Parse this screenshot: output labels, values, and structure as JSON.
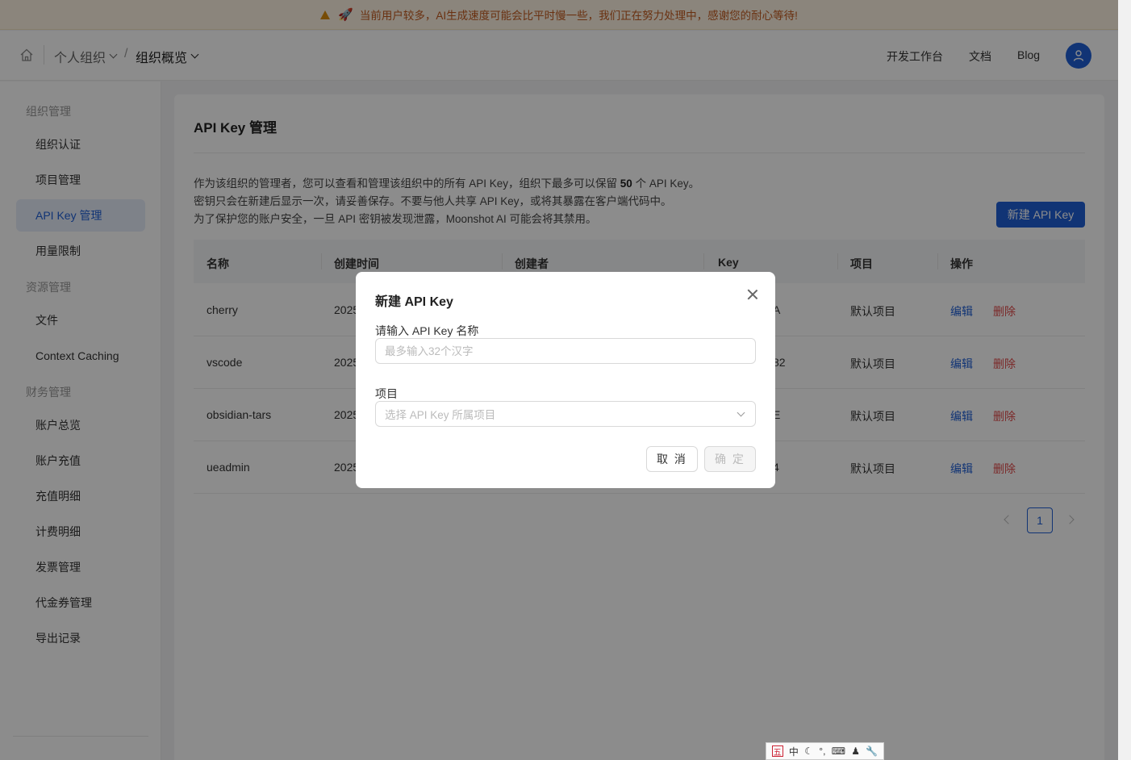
{
  "notice": {
    "text": "当前用户较多，AI生成速度可能会比平时慢一些，我们正在努力处理中，感谢您的耐心等待!"
  },
  "header": {
    "breadcrumb_org": "个人组织",
    "breadcrumb_sep": "/",
    "breadcrumb_current": "组织概览",
    "nav": [
      "开发工作台",
      "文档",
      "Blog"
    ]
  },
  "sidebar": {
    "sections": [
      "组织管理",
      "资源管理",
      "财务管理"
    ],
    "items": [
      "组织认证",
      "项目管理",
      "API Key 管理",
      "用量限制",
      "文件",
      "Context Caching",
      "账户总览",
      "账户充值",
      "充值明细",
      "计费明细",
      "发票管理",
      "代金券管理",
      "导出记录"
    ],
    "active_item": "API Key 管理"
  },
  "main": {
    "title": "API Key 管理",
    "desc_line1_pre": "作为该组织的管理者，您可以查看和管理该组织中的所有 API Key，组织下最多可以保留 ",
    "desc_limit": "50",
    "desc_line1_post": " 个 API Key。",
    "desc_line2": "密钥只会在新建后显示一次，请妥善保存。不要与他人共享 API Key，或将其暴露在客户端代码中。",
    "desc_line3": "为了保护您的账户安全，一旦 API 密钥被发现泄露，Moonshot AI 可能会将其禁用。",
    "new_button": "新建 API Key",
    "columns": [
      "名称",
      "创建时间",
      "创建者",
      "Key",
      "项目",
      "操作"
    ],
    "rows": [
      {
        "name": "cherry",
        "created": "2025",
        "key": "A",
        "project": "默认项目",
        "edit": "编辑",
        "delete": "删除"
      },
      {
        "name": "vscode",
        "created": "2025",
        "key": "82",
        "project": "默认项目",
        "edit": "编辑",
        "delete": "删除"
      },
      {
        "name": "obsidian-tars",
        "created": "2025",
        "key": "E",
        "project": "默认项目",
        "edit": "编辑",
        "delete": "删除"
      },
      {
        "name": "ueadmin",
        "created": "2025",
        "key": "4",
        "project": "默认项目",
        "edit": "编辑",
        "delete": "删除"
      }
    ],
    "pagination_current": "1"
  },
  "modal": {
    "title": "新建 API Key",
    "name_label": "请输入 API Key 名称",
    "name_placeholder": "最多输入32个汉字",
    "project_label": "项目",
    "project_placeholder": "选择 API Key 所属项目",
    "cancel": "取 消",
    "ok": "确 定"
  },
  "ime": {
    "mode": "中"
  },
  "colors": {
    "accent": "#1f5fd6",
    "danger": "#e04b4b",
    "notice_text": "#c15a1f"
  }
}
